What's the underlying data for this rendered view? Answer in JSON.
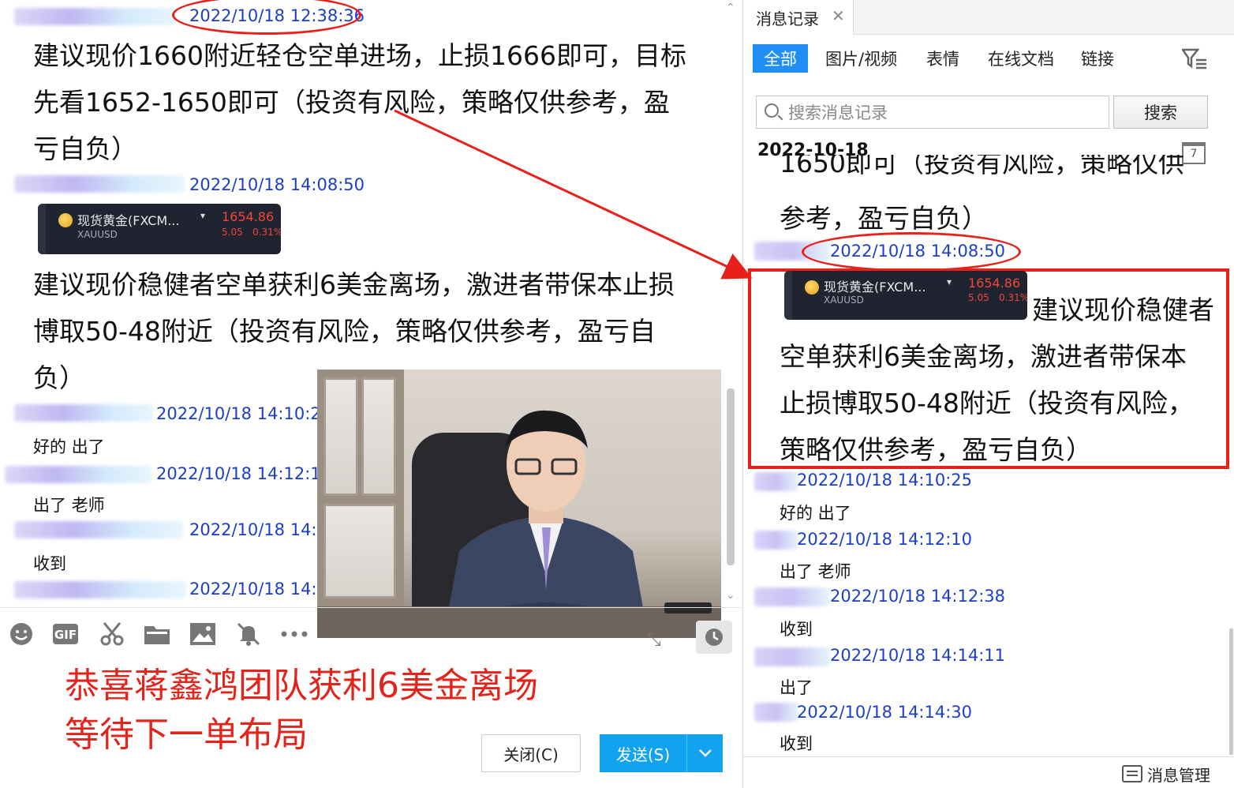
{
  "left": {
    "messages": [
      {
        "time": "2022/10/18 12:38:36",
        "lines": [
          "建议现价1660附近轻仓空单进场，止损1666即可，目标",
          "先看1652-1650即可（投资有风险，策略仅供参考，盈",
          "亏自负）"
        ]
      },
      {
        "time": "2022/10/18 14:08:50",
        "lines": [
          "建议现价稳健者空单获利6美金离场，激进者带保本止损",
          "博取50-48附近（投资有风险，策略仅供参考，盈亏自",
          "负）"
        ]
      },
      {
        "time": "2022/10/18 14:10:25",
        "text": "好的 出了"
      },
      {
        "time": "2022/10/18 14:12:10",
        "text": "出了 老师"
      },
      {
        "time": "2022/10/18 14:12:38",
        "text": "收到"
      },
      {
        "time": "2022/10/18 14:14:11"
      }
    ],
    "quote_card": {
      "name": "现货黄金(FXCM...",
      "symbol": "XAUUSD",
      "price": "1654.86",
      "change": "5.05",
      "change_pct": "0.31%"
    },
    "congrats_lines": [
      "恭喜蒋鑫鸿团队获利6美金离场",
      "等待下一单布局"
    ],
    "buttons": {
      "close": "关闭(C)",
      "send": "发送(S)"
    },
    "toolbar_icons": [
      "emoji-icon",
      "gif-icon",
      "scissors-icon",
      "folder-icon",
      "image-icon",
      "mute-bell-icon",
      "more-icon"
    ]
  },
  "right": {
    "panel_title": "消息记录",
    "filters": [
      "全部",
      "图片/视频",
      "表情",
      "在线文档",
      "链接"
    ],
    "search_placeholder": "搜索消息记录",
    "search_button": "搜索",
    "date_header": "2022-10-18",
    "calendar_day": "7",
    "partial_top_line": "1650即可（投资有风险，策略仅供",
    "partial_second_line": "参考，盈亏自负）",
    "highlighted": {
      "time": "2022/10/18 14:08:50",
      "first_line": "建议现价稳健者",
      "lines": [
        "空单获利6美金离场，激进者带保本",
        "止损博取50-48附近（投资有风险，",
        "策略仅供参考，盈亏自负）"
      ]
    },
    "entries": [
      {
        "time": "2022/10/18 14:10:25",
        "text": "好的 出了"
      },
      {
        "time": "2022/10/18 14:12:10",
        "text": "出了 老师"
      },
      {
        "time": "2022/10/18 14:12:38",
        "text": "收到"
      },
      {
        "time": "2022/10/18 14:14:11",
        "text": "出了"
      },
      {
        "time": "2022/10/18 14:14:30",
        "text": "收到"
      }
    ],
    "manage_label": "消息管理"
  },
  "colors": {
    "timestamp": "#1a3ec9",
    "annotation_red": "#e8201a",
    "accent_blue": "#1f8ff5",
    "price_red": "#f0463c"
  }
}
